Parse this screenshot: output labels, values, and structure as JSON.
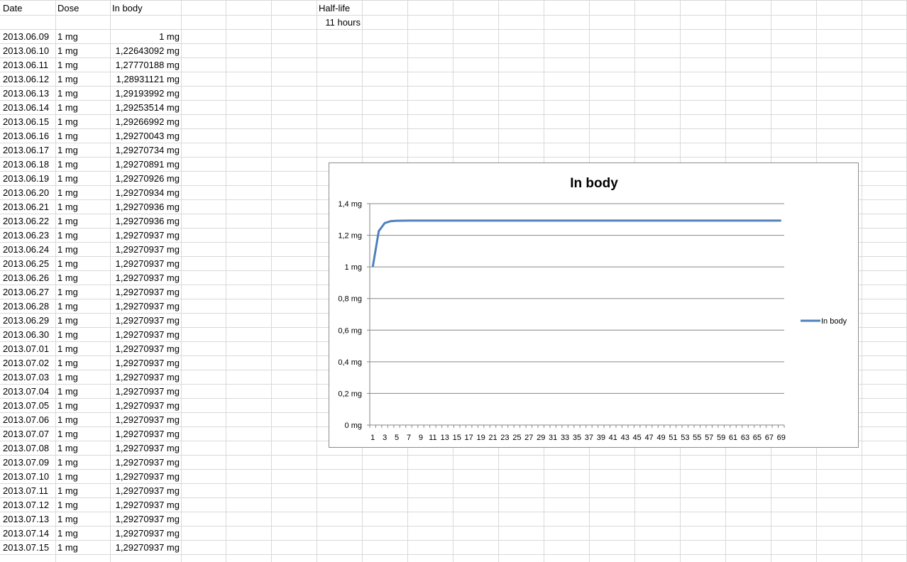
{
  "headers": {
    "date": "Date",
    "dose": "Dose",
    "in_body": "In body",
    "half_life": "Half-life"
  },
  "half_life_value": "11 hours",
  "rows": [
    {
      "date": "2013.06.09",
      "dose": "1 mg",
      "in_body": "1 mg"
    },
    {
      "date": "2013.06.10",
      "dose": "1 mg",
      "in_body": "1,22643092 mg"
    },
    {
      "date": "2013.06.11",
      "dose": "1 mg",
      "in_body": "1,27770188 mg"
    },
    {
      "date": "2013.06.12",
      "dose": "1 mg",
      "in_body": "1,28931121 mg"
    },
    {
      "date": "2013.06.13",
      "dose": "1 mg",
      "in_body": "1,29193992 mg"
    },
    {
      "date": "2013.06.14",
      "dose": "1 mg",
      "in_body": "1,29253514 mg"
    },
    {
      "date": "2013.06.15",
      "dose": "1 mg",
      "in_body": "1,29266992 mg"
    },
    {
      "date": "2013.06.16",
      "dose": "1 mg",
      "in_body": "1,29270043 mg"
    },
    {
      "date": "2013.06.17",
      "dose": "1 mg",
      "in_body": "1,29270734 mg"
    },
    {
      "date": "2013.06.18",
      "dose": "1 mg",
      "in_body": "1,29270891 mg"
    },
    {
      "date": "2013.06.19",
      "dose": "1 mg",
      "in_body": "1,29270926 mg"
    },
    {
      "date": "2013.06.20",
      "dose": "1 mg",
      "in_body": "1,29270934 mg"
    },
    {
      "date": "2013.06.21",
      "dose": "1 mg",
      "in_body": "1,29270936 mg"
    },
    {
      "date": "2013.06.22",
      "dose": "1 mg",
      "in_body": "1,29270936 mg"
    },
    {
      "date": "2013.06.23",
      "dose": "1 mg",
      "in_body": "1,29270937 mg"
    },
    {
      "date": "2013.06.24",
      "dose": "1 mg",
      "in_body": "1,29270937 mg"
    },
    {
      "date": "2013.06.25",
      "dose": "1 mg",
      "in_body": "1,29270937 mg"
    },
    {
      "date": "2013.06.26",
      "dose": "1 mg",
      "in_body": "1,29270937 mg"
    },
    {
      "date": "2013.06.27",
      "dose": "1 mg",
      "in_body": "1,29270937 mg"
    },
    {
      "date": "2013.06.28",
      "dose": "1 mg",
      "in_body": "1,29270937 mg"
    },
    {
      "date": "2013.06.29",
      "dose": "1 mg",
      "in_body": "1,29270937 mg"
    },
    {
      "date": "2013.06.30",
      "dose": "1 mg",
      "in_body": "1,29270937 mg"
    },
    {
      "date": "2013.07.01",
      "dose": "1 mg",
      "in_body": "1,29270937 mg"
    },
    {
      "date": "2013.07.02",
      "dose": "1 mg",
      "in_body": "1,29270937 mg"
    },
    {
      "date": "2013.07.03",
      "dose": "1 mg",
      "in_body": "1,29270937 mg"
    },
    {
      "date": "2013.07.04",
      "dose": "1 mg",
      "in_body": "1,29270937 mg"
    },
    {
      "date": "2013.07.05",
      "dose": "1 mg",
      "in_body": "1,29270937 mg"
    },
    {
      "date": "2013.07.06",
      "dose": "1 mg",
      "in_body": "1,29270937 mg"
    },
    {
      "date": "2013.07.07",
      "dose": "1 mg",
      "in_body": "1,29270937 mg"
    },
    {
      "date": "2013.07.08",
      "dose": "1 mg",
      "in_body": "1,29270937 mg"
    },
    {
      "date": "2013.07.09",
      "dose": "1 mg",
      "in_body": "1,29270937 mg"
    },
    {
      "date": "2013.07.10",
      "dose": "1 mg",
      "in_body": "1,29270937 mg"
    },
    {
      "date": "2013.07.11",
      "dose": "1 mg",
      "in_body": "1,29270937 mg"
    },
    {
      "date": "2013.07.12",
      "dose": "1 mg",
      "in_body": "1,29270937 mg"
    },
    {
      "date": "2013.07.13",
      "dose": "1 mg",
      "in_body": "1,29270937 mg"
    },
    {
      "date": "2013.07.14",
      "dose": "1 mg",
      "in_body": "1,29270937 mg"
    },
    {
      "date": "2013.07.15",
      "dose": "1 mg",
      "in_body": "1,29270937 mg"
    }
  ],
  "chart_data": {
    "type": "line",
    "title": "In body",
    "xlabel": "",
    "ylabel": "",
    "ylim": [
      0,
      1.4
    ],
    "y_ticks": [
      "0 mg",
      "0,2 mg",
      "0,4 mg",
      "0,6 mg",
      "0,8 mg",
      "1 mg",
      "1,2 mg",
      "1,4 mg"
    ],
    "y_tick_values": [
      0,
      0.2,
      0.4,
      0.6,
      0.8,
      1.0,
      1.2,
      1.4
    ],
    "x_tick_labels": [
      "1",
      "3",
      "5",
      "7",
      "9",
      "11",
      "13",
      "15",
      "17",
      "19",
      "21",
      "23",
      "25",
      "27",
      "29",
      "31",
      "33",
      "35",
      "37",
      "39",
      "41",
      "43",
      "45",
      "47",
      "49",
      "51",
      "53",
      "55",
      "57",
      "59",
      "61",
      "63",
      "65",
      "67",
      "69"
    ],
    "x_count": 69,
    "gridlines": true,
    "legend_position": "right",
    "series": [
      {
        "name": "In body",
        "color": "#4f81bd",
        "values": [
          1.0,
          1.22643092,
          1.27770188,
          1.28931121,
          1.29193992,
          1.29253514,
          1.29266992,
          1.29270043,
          1.29270734,
          1.29270891,
          1.29270926,
          1.29270934,
          1.29270936,
          1.29270936,
          1.29270937,
          1.29270937,
          1.29270937,
          1.29270937,
          1.29270937,
          1.29270937,
          1.29270937,
          1.29270937,
          1.29270937,
          1.29270937,
          1.29270937,
          1.29270937,
          1.29270937,
          1.29270937,
          1.29270937,
          1.29270937,
          1.29270937,
          1.29270937,
          1.29270937,
          1.29270937,
          1.29270937,
          1.29270937,
          1.29270937,
          1.29270937,
          1.29270937,
          1.29270937,
          1.29270937,
          1.29270937,
          1.29270937,
          1.29270937,
          1.29270937,
          1.29270937,
          1.29270937,
          1.29270937,
          1.29270937,
          1.29270937,
          1.29270937,
          1.29270937,
          1.29270937,
          1.29270937,
          1.29270937,
          1.29270937,
          1.29270937,
          1.29270937,
          1.29270937,
          1.29270937,
          1.29270937,
          1.29270937,
          1.29270937,
          1.29270937,
          1.29270937,
          1.29270937,
          1.29270937,
          1.29270937,
          1.29270937
        ]
      }
    ]
  },
  "colors": {
    "gridline": "#d9d9d9",
    "chart_border": "#8c8c8c",
    "chart_grid": "#868686",
    "series": "#4f81bd"
  }
}
